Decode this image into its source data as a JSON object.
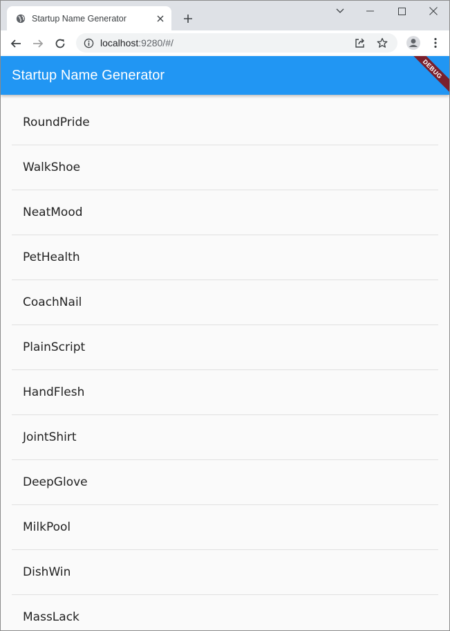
{
  "browser": {
    "tab": {
      "title": "Startup Name Generator"
    },
    "address": {
      "host": "localhost",
      "path": ":9280/#/"
    }
  },
  "app": {
    "title": "Startup Name Generator",
    "debug_banner": "DEBUG",
    "accent_color": "#2196f3",
    "names": [
      "RoundPride",
      "WalkShoe",
      "NeatMood",
      "PetHealth",
      "CoachNail",
      "PlainScript",
      "HandFlesh",
      "JointShirt",
      "DeepGlove",
      "MilkPool",
      "DishWin",
      "MassLack"
    ]
  }
}
